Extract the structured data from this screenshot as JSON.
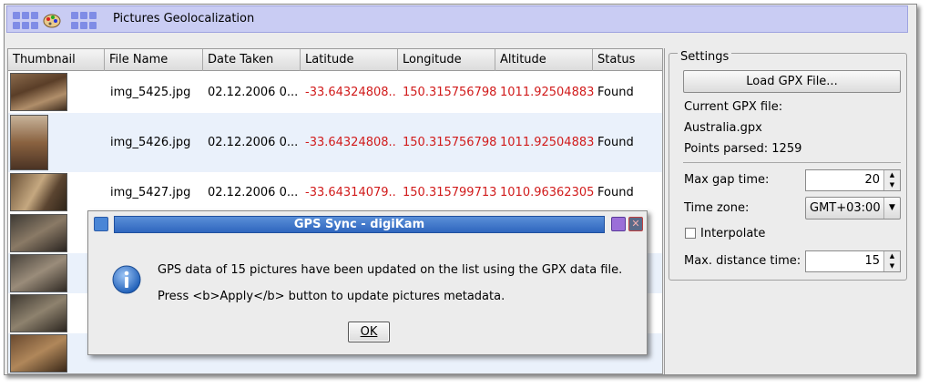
{
  "window": {
    "title": "Pictures Geolocalization"
  },
  "table": {
    "headers": [
      "Thumbnail",
      "File Name",
      "Date Taken",
      "Latitude",
      "Longitude",
      "Altitude",
      "Status"
    ],
    "rows": [
      {
        "file": "img_5425.jpg",
        "date": "02.12.2006 0...",
        "lat": "-33.64324808...",
        "lon": "150.315756798",
        "alt": "1011.92504883",
        "status": "Found"
      },
      {
        "file": "img_5426.jpg",
        "date": "02.12.2006 0...",
        "lat": "-33.64324808...",
        "lon": "150.315756798",
        "alt": "1011.92504883",
        "status": "Found"
      },
      {
        "file": "img_5427.jpg",
        "date": "02.12.2006 0...",
        "lat": "-33.64314079...",
        "lon": "150.315799713",
        "alt": "1010.96362305",
        "status": "Found"
      }
    ]
  },
  "settings": {
    "group_title": "Settings",
    "load_button": "Load GPX File...",
    "current_label": "Current GPX file:",
    "current_file": "Australia.gpx",
    "points_parsed": "Points parsed: 1259",
    "max_gap_label": "Max gap time:",
    "max_gap_value": "20",
    "time_zone_label": "Time zone:",
    "time_zone_value": "GMT+03:00",
    "interpolate_label": "Interpolate",
    "interpolate_checked": false,
    "max_distance_label": "Max. distance time:",
    "max_distance_value": "15"
  },
  "dialog": {
    "title": "GPS Sync - digiKam",
    "message1": "GPS data of 15 pictures have been updated on the list using the GPX data file.",
    "message2": "Press <b>Apply</b> button to update pictures metadata.",
    "ok": "OK"
  },
  "colors": {
    "title_bg": "#c9ccf3",
    "dialog_title": "#2f66be",
    "coord_red": "#d11b1b",
    "alt_row": "#eaf1fb"
  },
  "icons": [
    "app-grid-icon",
    "paint-palette-icon",
    "info-icon",
    "dropdown-arrow-icon",
    "spin-arrows-icon",
    "minimize-icon",
    "close-icon"
  ]
}
